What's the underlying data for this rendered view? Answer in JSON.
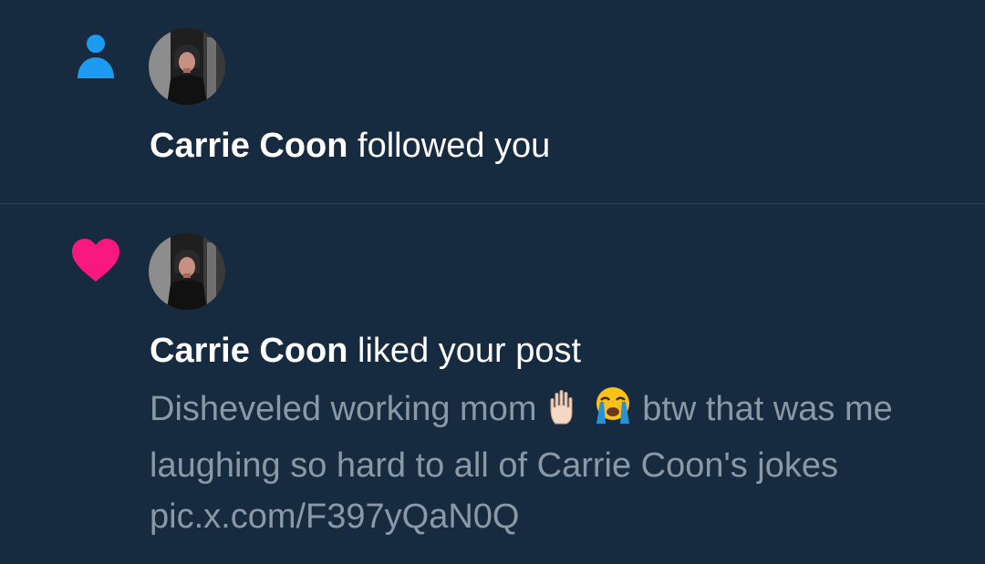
{
  "notifications": [
    {
      "type_icon": "person-icon",
      "name": "Carrie Coon",
      "action": "followed you"
    },
    {
      "type_icon": "heart-icon",
      "name": "Carrie Coon",
      "action": "liked your post",
      "post": {
        "text_part1": "Disheveled working mom",
        "emoji_1": "raised-hand-icon",
        "emoji_2": "crying-face-icon",
        "text_part2": "btw that was me laughing so hard to all of Carrie Coon's jokes pic.x.com/F397yQaN0Q"
      }
    }
  ],
  "colors": {
    "background": "#172b40",
    "follow_icon": "#1d9bf0",
    "like_icon": "#f91880",
    "secondary_text": "#8b98a5"
  }
}
